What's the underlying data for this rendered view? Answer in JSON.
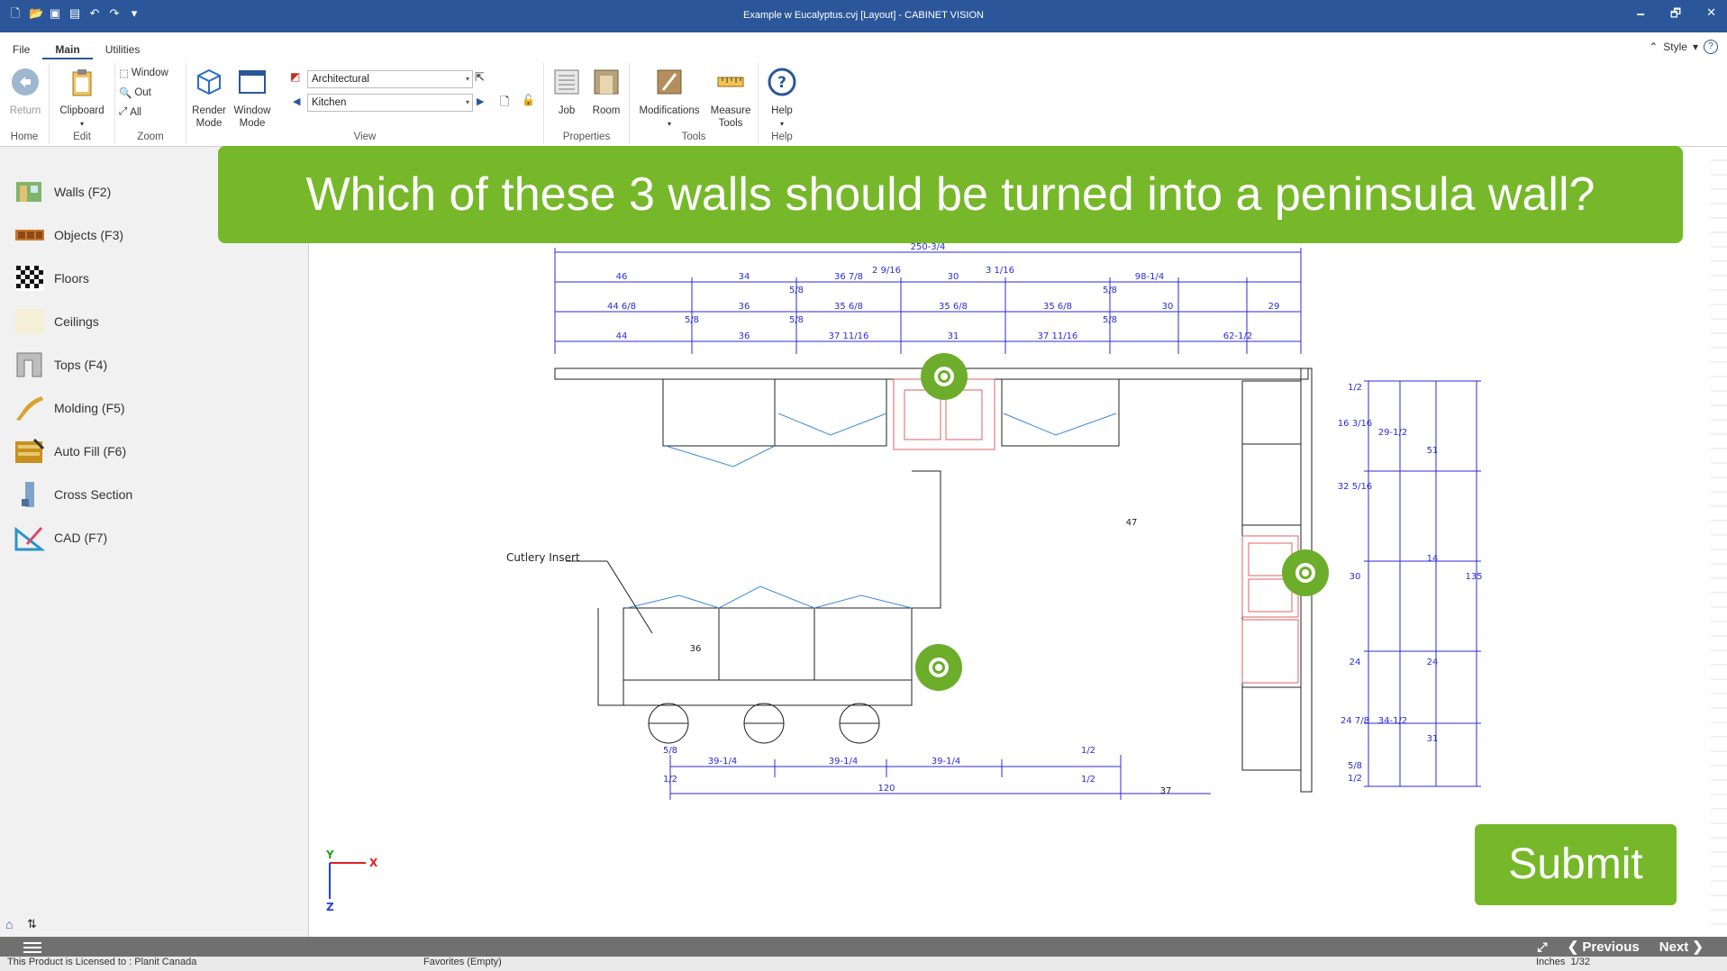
{
  "titlebar": {
    "title": "Example w Eucalyptus.cvj [Layout] - CABINET VISION",
    "minimize": "🗕",
    "restore": "🗗",
    "close": "✕"
  },
  "ribbon": {
    "tabs": [
      "File",
      "Main",
      "Utilities"
    ],
    "style_label": "Style",
    "groups": {
      "home": {
        "label": "Home",
        "return_label": "Return"
      },
      "edit": {
        "label": "Edit",
        "clipboard_label": "Clipboard"
      },
      "zoom": {
        "label": "Zoom",
        "window": "Window",
        "out": "Out",
        "all": "All"
      },
      "view": {
        "label": "View",
        "render_mode": "Render\nMode",
        "window_mode": "Window\nMode",
        "style_value": "Architectural",
        "room_value": "Kitchen"
      },
      "properties": {
        "label": "Properties",
        "job": "Job",
        "room": "Room"
      },
      "tools": {
        "label": "Tools",
        "modifications": "Modifications",
        "measure_tools": "Measure\nTools"
      },
      "help": {
        "label": "Help",
        "help": "Help"
      }
    }
  },
  "sidebar": {
    "items": [
      {
        "label": "Walls (F2)"
      },
      {
        "label": "Objects (F3)"
      },
      {
        "label": "Floors"
      },
      {
        "label": "Ceilings"
      },
      {
        "label": "Tops (F4)"
      },
      {
        "label": "Molding (F5)"
      },
      {
        "label": "Auto Fill (F6)"
      },
      {
        "label": "Cross Section"
      },
      {
        "label": "CAD (F7)"
      }
    ]
  },
  "drawing": {
    "annotation": "Cutlery Insert",
    "axis_x": "X",
    "axis_y": "Y",
    "axis_z": "Z",
    "dims_top": [
      "250-3/4",
      "2 9/16",
      "3 1/16",
      "46",
      "34",
      "36 7/8",
      "30",
      "98-1/4",
      "5/8",
      "5/8",
      "44 6/8",
      "36",
      "35 6/8",
      "35 6/8",
      "35 6/8",
      "30",
      "29",
      "5/8",
      "5/8",
      "5/8",
      "44",
      "36",
      "37 11/16",
      "31",
      "37 11/16",
      "62-1/2"
    ],
    "dims_bottom": [
      "5/8",
      "39-1/4",
      "39-1/4",
      "39-1/4",
      "1/2",
      "1/2",
      "1/2",
      "120",
      "37"
    ],
    "dims_right": [
      "1/2",
      "16 3/16",
      "29-1/2",
      "51",
      "32 5/16",
      "30",
      "14",
      "135",
      "24",
      "24",
      "24 7/8",
      "34-1/2",
      "31",
      "5/8",
      "1/2"
    ],
    "dims_mid": [
      "47",
      "36"
    ]
  },
  "quiz": {
    "question": "Which of these 3 walls should be turned into a peninsula wall?",
    "submit_label": "Submit",
    "previous_label": "Previous",
    "next_label": "Next"
  },
  "statusbar": {
    "license": "This Product is Licensed to : Planit Canada",
    "favorites": "Favorites (Empty)",
    "units": "Inches",
    "scale": "1/32"
  },
  "colors": {
    "titlebar": "#2b579a",
    "quiz_green": "#76b82a",
    "dimension_blue": "#2b2bd8",
    "appliance_red": "#e06060"
  }
}
